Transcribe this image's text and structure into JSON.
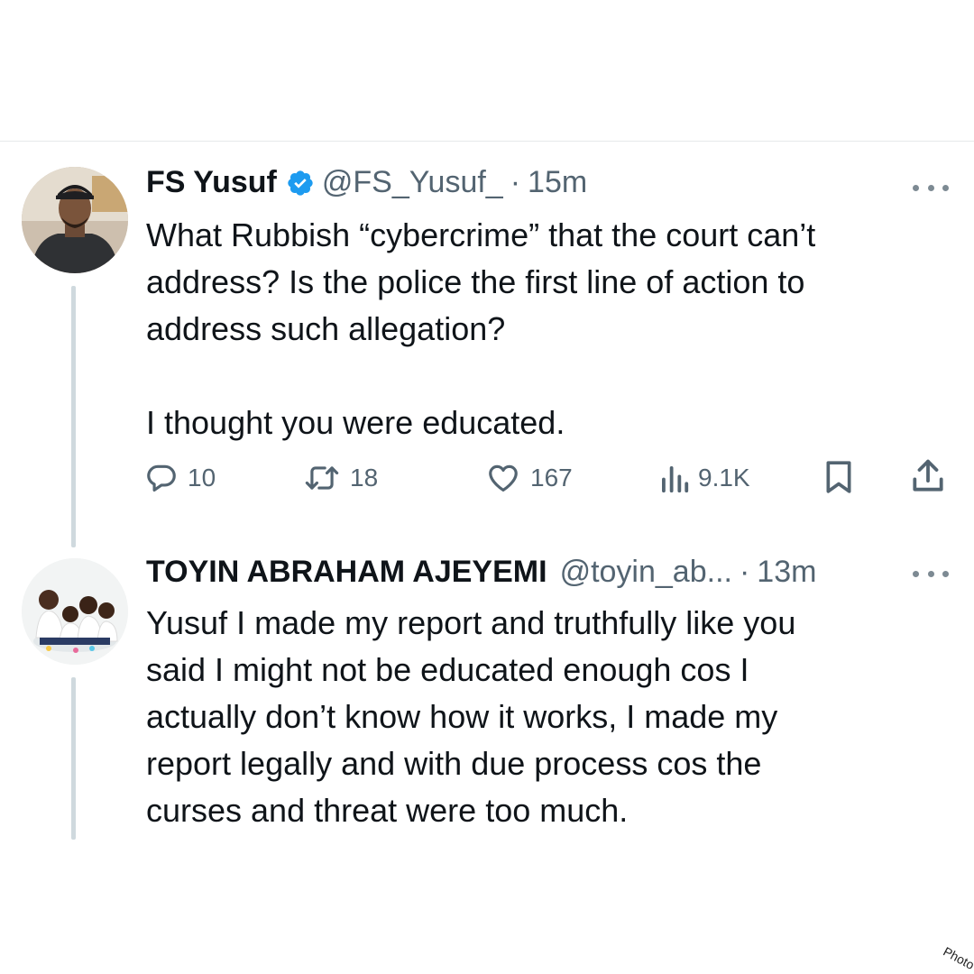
{
  "tweets": [
    {
      "name": "FS Yusuf",
      "verified": true,
      "handle": "@FS_Yusuf_",
      "separator": "·",
      "time": "15m",
      "text": "What Rubbish “cybercrime” that the court can’t\naddress? Is the police the first line of action to\naddress such allegation?\n\nI thought you were educated.",
      "stats": {
        "replies": "10",
        "reposts": "18",
        "likes": "167",
        "views": "9.1K"
      }
    },
    {
      "name": "TOYIN ABRAHAM AJEYEMI",
      "handle": "@toyin_ab...",
      "separator": "·",
      "time": "13m",
      "text": "Yusuf I made my report and truthfully like you\nsaid I might not be educated enough cos I\nactually don’t know how it works, I made my\nreport legally and with due process cos the\ncurses and threat were too much."
    }
  ],
  "icons": {
    "verified": "verified-badge-icon",
    "more": "more-options-icon",
    "reply": "reply-icon",
    "repost": "repost-icon",
    "like": "heart-icon",
    "views": "views-chart-icon",
    "bookmark": "bookmark-icon",
    "share": "share-icon"
  },
  "colors": {
    "verified": "#1d9bf0",
    "text": "#0f1419",
    "secondary": "#536471",
    "thread": "#cfd9de"
  },
  "watermark": "Photo"
}
